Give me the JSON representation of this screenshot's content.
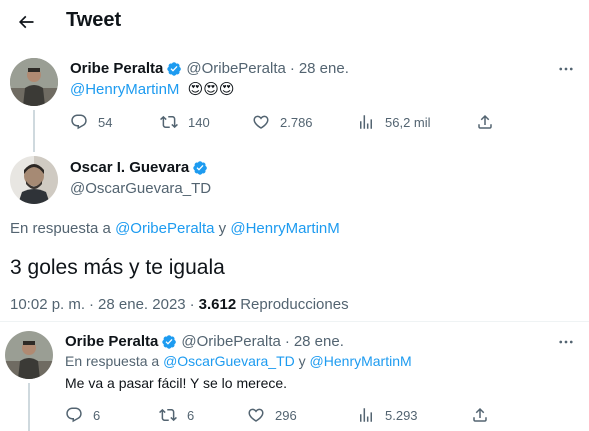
{
  "header": {
    "title": "Tweet"
  },
  "tweet1": {
    "name": "Oribe Peralta",
    "handle": "@OribePeralta",
    "dot": "·",
    "date": "28 ene.",
    "mention": "@HenryMartinM",
    "emojis": "😍😍😍",
    "stats": {
      "replies": "54",
      "retweets": "140",
      "likes": "2.786",
      "views": "56,2 mil"
    }
  },
  "main": {
    "name": "Oscar I. Guevara",
    "handle": "@OscarGuevara_TD",
    "reply_prefix": "En respuesta a ",
    "reply_to1": "@OribePeralta",
    "reply_and": " y ",
    "reply_to2": "@HenryMartinM",
    "text": "3 goles más y te iguala",
    "time": "10:02 p. m.",
    "dot": "·",
    "date": "28 ene. 2023",
    "views_count": "3.612",
    "views_label": "Reproducciones"
  },
  "reply": {
    "name": "Oribe Peralta",
    "handle": "@OribePeralta",
    "dot": "·",
    "date": "28 ene.",
    "reply_prefix": "En respuesta a ",
    "reply_to1": "@OscarGuevara_TD",
    "reply_and": " y ",
    "reply_to2": "@HenryMartinM",
    "text": "Me va a pasar fácil! Y se lo merece.",
    "stats": {
      "replies": "6",
      "retweets": "6",
      "likes": "296",
      "views": "5.293"
    }
  },
  "colors": {
    "accent": "#1d9bf0",
    "muted": "#536471",
    "text": "#0f1419",
    "line": "#cfd9de"
  },
  "icons": [
    "back-arrow-icon",
    "verified-badge-icon",
    "more-icon",
    "reply-icon",
    "retweet-icon",
    "like-icon",
    "views-icon",
    "share-icon"
  ]
}
